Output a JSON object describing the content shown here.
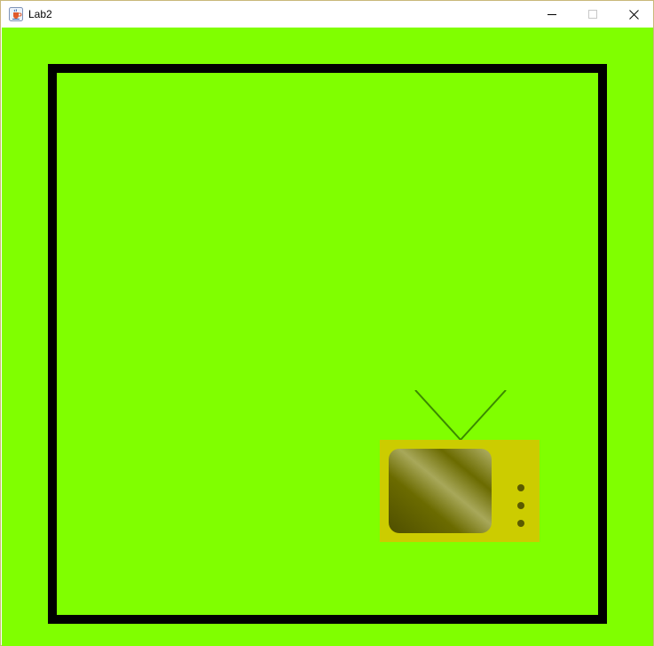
{
  "window": {
    "title": "Lab2",
    "app_icon": "java-coffee-icon",
    "controls": {
      "minimize_icon": "minimize-icon",
      "maximize_icon": "maximize-icon",
      "close_icon": "close-icon"
    }
  },
  "scene": {
    "background_color": "#80ff00",
    "frame_color": "#000000",
    "tv": {
      "body_color": "#cccc00",
      "antenna_color": "#3a8a00",
      "screen_gradient": [
        "#4f4f00",
        "#a8a85a",
        "#6b6b00",
        "#b3b36a"
      ],
      "knob_color": "#5a5a00",
      "knob_count": 3
    }
  }
}
